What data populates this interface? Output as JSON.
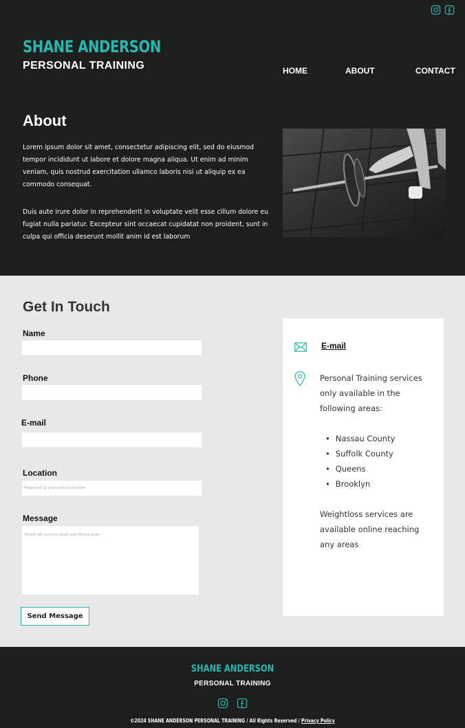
{
  "colors": {
    "accent": "#27b8ad",
    "dark": "#1d1e1e",
    "light": "#e8e8e8"
  },
  "header": {
    "social": [
      {
        "icon": "instagram-icon"
      },
      {
        "icon": "facebook-icon"
      }
    ],
    "brand_name": "SHANE ANDERSON",
    "brand_sub": "PERSONAL TRAINING",
    "nav": [
      {
        "label": "HOME"
      },
      {
        "label": "ABOUT"
      },
      {
        "label": "CONTACT"
      }
    ]
  },
  "about": {
    "title": "About",
    "p1": "Lorem ipsum dolor sit amet, consectetur adipiscing elit, sed do eiusmod tempor incididunt ut labore et dolore magna aliqua. Ut enim ad minim veniam, quis nostrud exercitation ullamco laboris nisi ut aliquip ex ea commodo consequat.",
    "p2": "Duis aute irure dolor in reprehenderit in voluptate velit esse cillum dolore eu fugiat nulla pariatur. Excepteur sint occaecat cupidatat non proident, sunt in culpa qui officia deserunt mollit anim id est laborum"
  },
  "contact": {
    "title": "Get In Touch",
    "form": {
      "name_label": "Name",
      "name_value": "",
      "phone_label": "Phone",
      "phone_value": "",
      "email_label": "E-mail",
      "email_value": "",
      "location_label": "Location",
      "location_placeholder": "Please tell us your town or zip code",
      "message_label": "Message",
      "message_placeholder": "Please tell us more about your fitness goals",
      "submit_label": "Send Message"
    },
    "card": {
      "email_link": "E-mail",
      "service_text": "Personal Training services only available in the following areas:",
      "areas": [
        "Nassau County",
        "Suffolk County",
        "Queens",
        "Brooklyn"
      ],
      "weightloss_text": "Weightloss services are available online reaching any areas"
    }
  },
  "footer": {
    "brand_name": "SHANE ANDERSON",
    "brand_sub": "PERSONAL TRAINING",
    "copyright": "©2024 SHANE ANDERSON PERSONAL TRAINING / All Rights Reserved / ",
    "privacy": "Privacy Policy"
  }
}
